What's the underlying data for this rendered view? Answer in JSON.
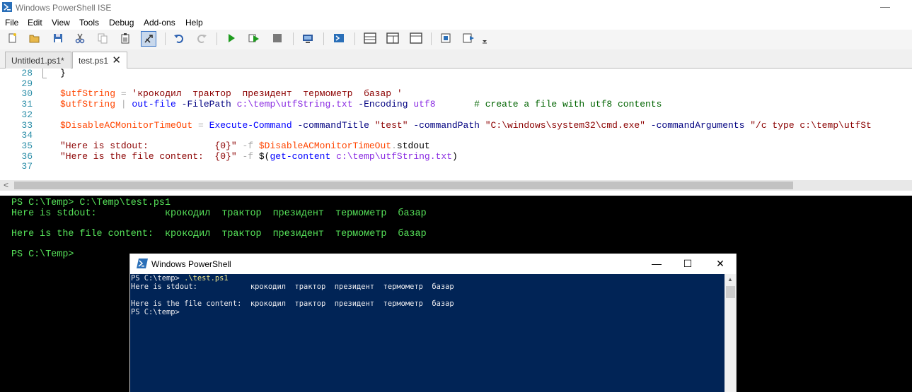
{
  "app": {
    "title": "Windows PowerShell ISE",
    "minimize_glyph": "—"
  },
  "menu": [
    "File",
    "Edit",
    "View",
    "Tools",
    "Debug",
    "Add-ons",
    "Help"
  ],
  "tabs": [
    {
      "label": "Untitled1.ps1*",
      "active": false
    },
    {
      "label": "test.ps1",
      "active": true,
      "close_glyph": "✕"
    }
  ],
  "editor": {
    "lines": [
      {
        "num": "28",
        "tokens": [
          {
            "c": "plain",
            "t": "}"
          }
        ]
      },
      {
        "num": "29",
        "tokens": []
      },
      {
        "num": "30",
        "tokens": [
          {
            "c": "var",
            "t": "$utfString"
          },
          {
            "c": "op",
            "t": " = "
          },
          {
            "c": "str",
            "t": "'крокодил  трактор  президент  термометр  базар '"
          }
        ]
      },
      {
        "num": "31",
        "tokens": [
          {
            "c": "var",
            "t": "$utfString"
          },
          {
            "c": "op",
            "t": " | "
          },
          {
            "c": "cmd",
            "t": "out-file"
          },
          {
            "c": "par",
            "t": " -FilePath "
          },
          {
            "c": "arg",
            "t": "c:\\temp\\utfString.txt"
          },
          {
            "c": "par",
            "t": " -Encoding "
          },
          {
            "c": "arg",
            "t": "utf8"
          },
          {
            "c": "plain",
            "t": "       "
          },
          {
            "c": "cmt",
            "t": "# create a file with utf8 contents"
          }
        ]
      },
      {
        "num": "32",
        "tokens": []
      },
      {
        "num": "33",
        "tokens": [
          {
            "c": "var",
            "t": "$DisableACMonitorTimeOut"
          },
          {
            "c": "op",
            "t": " = "
          },
          {
            "c": "cmd",
            "t": "Execute-Command"
          },
          {
            "c": "par",
            "t": " -commandTitle "
          },
          {
            "c": "str",
            "t": "\"test\""
          },
          {
            "c": "par",
            "t": " -commandPath "
          },
          {
            "c": "str",
            "t": "\"C:\\windows\\system32\\cmd.exe\""
          },
          {
            "c": "par",
            "t": " -commandArguments "
          },
          {
            "c": "str",
            "t": "\"/c type c:\\temp\\utfSt"
          }
        ]
      },
      {
        "num": "34",
        "tokens": []
      },
      {
        "num": "35",
        "tokens": [
          {
            "c": "str",
            "t": "\"Here is stdout:            {0}\""
          },
          {
            "c": "op",
            "t": " -f "
          },
          {
            "c": "var",
            "t": "$DisableACMonitorTimeOut"
          },
          {
            "c": "op",
            "t": "."
          },
          {
            "c": "prop",
            "t": "stdout"
          }
        ]
      },
      {
        "num": "36",
        "tokens": [
          {
            "c": "str",
            "t": "\"Here is the file content:  {0}\""
          },
          {
            "c": "op",
            "t": " -f "
          },
          {
            "c": "plain",
            "t": "$("
          },
          {
            "c": "cmd",
            "t": "get-content"
          },
          {
            "c": "plain",
            "t": " "
          },
          {
            "c": "arg",
            "t": "c:\\temp\\utfString.txt"
          },
          {
            "c": "plain",
            "t": ")"
          }
        ]
      },
      {
        "num": "37",
        "tokens": []
      }
    ]
  },
  "scroll_arrow": "<",
  "console": {
    "lines": [
      "PS C:\\Temp> C:\\Temp\\test.ps1",
      "Here is stdout:            крокодил  трактор  президент  термометр  базар",
      "",
      "Here is the file content:  крокодил  трактор  президент  термометр  базар",
      "",
      "PS C:\\Temp>"
    ]
  },
  "ps_window": {
    "title": "Windows PowerShell",
    "minimize": "—",
    "maximize": "☐",
    "close": "✕",
    "prompt": "PS C:\\temp> ",
    "command": ".\\test.ps1",
    "lines": [
      "Here is stdout:            крокодил  трактор  президент  термометр  базар",
      "",
      "Here is the file content:  крокодил  трактор  президент  термометр  базар",
      "PS C:\\temp>"
    ],
    "scroll_up": "▲"
  },
  "toolbar_icons": [
    "new-file-icon",
    "open-folder-icon",
    "save-icon",
    "cut-icon",
    "copy-icon",
    "paste-icon",
    "powershell-tab-icon",
    "undo-icon",
    "redo-icon",
    "run-icon",
    "run-selection-icon",
    "stop-icon",
    "remote-icon",
    "console-icon",
    "layout-top-icon",
    "layout-right-icon",
    "layout-max-icon",
    "addon-icon",
    "show-command-icon",
    "overflow-icon"
  ]
}
